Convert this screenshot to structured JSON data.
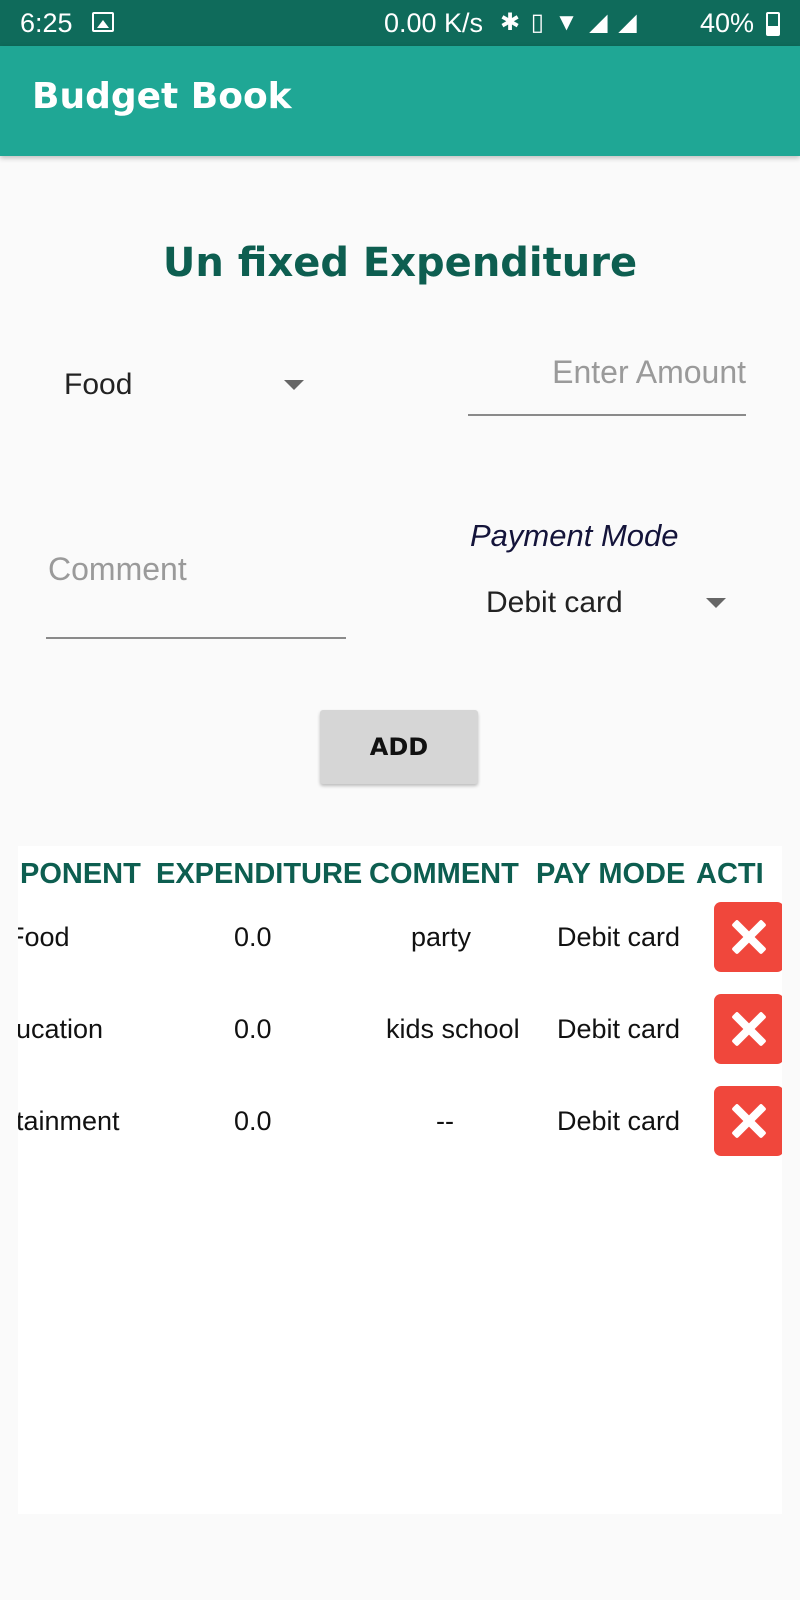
{
  "status_bar": {
    "time": "6:25",
    "net_speed": "0.00 K/s",
    "icons": [
      "bluetooth-icon",
      "vibrate-icon",
      "wifi-icon",
      "signal-icon",
      "signal-icon",
      "battery-icon"
    ],
    "battery": "40%"
  },
  "app_bar": {
    "title": "Budget Book"
  },
  "form": {
    "title": "Un fixed Expenditure",
    "category": "Food",
    "amount_placeholder": "Enter Amount",
    "comment_placeholder": "Comment",
    "payment_label": "Payment Mode",
    "payment_mode": "Debit card",
    "add_label": "ADD"
  },
  "table": {
    "headers": [
      "PONENT",
      "EXPENDITURE",
      "COMMENT",
      "PAY MODE",
      "ACTI"
    ],
    "rows": [
      {
        "component": "Food",
        "expenditure": "0.0",
        "comment": "party",
        "pay_mode": "Debit card"
      },
      {
        "component": "ucation",
        "expenditure": "0.0",
        "comment": "kids school",
        "pay_mode": "Debit card"
      },
      {
        "component": "tainment",
        "expenditure": "0.0",
        "comment": "--",
        "pay_mode": "Debit card"
      }
    ]
  },
  "colors": {
    "status_bar": "#0f6b5b",
    "app_bar": "#1fa795",
    "accent": "#0d5e50",
    "delete": "#f0473c"
  }
}
